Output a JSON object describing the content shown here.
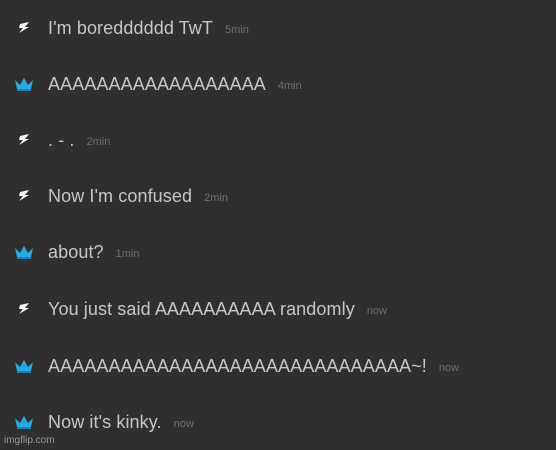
{
  "messages": [
    {
      "icon": "bolt-icon",
      "text": "I'm boredddddd TwT",
      "time": "5min"
    },
    {
      "icon": "crown-icon",
      "text": "AAAAAAAAAAAAAAAAAA",
      "time": "4min"
    },
    {
      "icon": "bolt-icon",
      "text": ". - .",
      "time": "2min"
    },
    {
      "icon": "bolt-icon",
      "text": "Now I'm confused",
      "time": "2min"
    },
    {
      "icon": "crown-icon",
      "text": "about?",
      "time": "1min"
    },
    {
      "icon": "bolt-icon",
      "text": "You just said AAAAAAAAAA randomly",
      "time": "now"
    },
    {
      "icon": "crown-icon",
      "text": "AAAAAAAAAAAAAAAAAAAAAAAAAAAAAA~!",
      "time": "now"
    },
    {
      "icon": "crown-icon",
      "text": "Now it's kinky.",
      "time": "now"
    }
  ],
  "watermark": "imgflip.com",
  "colors": {
    "background": "#2f2f2f",
    "text": "#c7c7c7",
    "time": "#6e6e6e",
    "crown": "#29a8e0",
    "bolt": "#ffffff"
  }
}
